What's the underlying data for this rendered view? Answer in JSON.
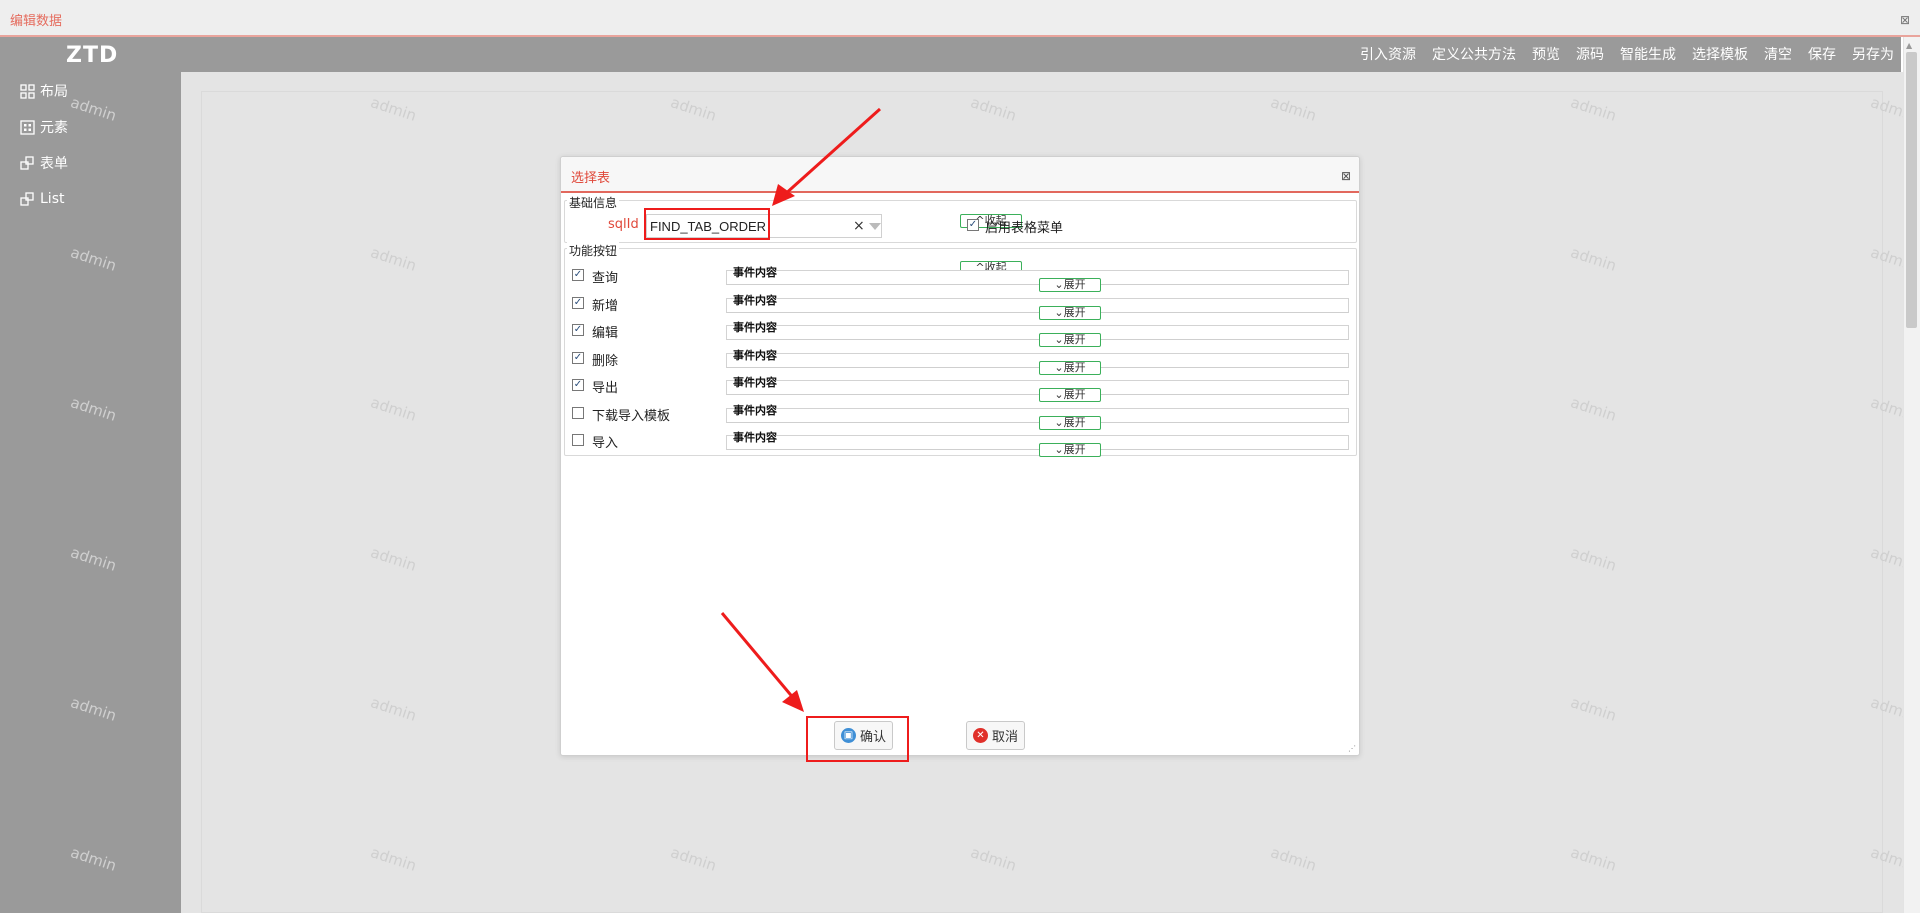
{
  "window": {
    "title": "编辑数据"
  },
  "app": {
    "logo": "ZTD",
    "sidebar": [
      {
        "label": "布局",
        "icon": "grid-icon"
      },
      {
        "label": "元素",
        "icon": "grid-box-icon"
      },
      {
        "label": "表单",
        "icon": "form-icon"
      },
      {
        "label": "List",
        "icon": "list-icon"
      }
    ],
    "top_menu": [
      "引入资源",
      "定义公共方法",
      "预览",
      "源码",
      "智能生成",
      "选择模板",
      "清空",
      "保存",
      "另存为"
    ],
    "watermark": "admin"
  },
  "dialog": {
    "title": "选择表",
    "basic_section": "基础信息",
    "sqlid_label": "sqlId",
    "sqlid_value": "FIND_TAB_ORDER",
    "collapse_label": "^收起",
    "enable_table_menu": "启用表格菜单",
    "func_section": "功能按钮",
    "event_label": "事件内容",
    "expand_label": "⌄展开",
    "buttons": [
      {
        "label": "查询",
        "checked": true
      },
      {
        "label": "新增",
        "checked": true
      },
      {
        "label": "编辑",
        "checked": true
      },
      {
        "label": "删除",
        "checked": true
      },
      {
        "label": "导出",
        "checked": true
      },
      {
        "label": "下载导入模板",
        "checked": false
      },
      {
        "label": "导入",
        "checked": false
      }
    ],
    "confirm": "确认",
    "cancel": "取消"
  },
  "colors": {
    "accent": "#e0483a",
    "sidebar": "#9a9a9a",
    "annotation": "#ee1c1c",
    "pill_border": "#3bb05a"
  }
}
